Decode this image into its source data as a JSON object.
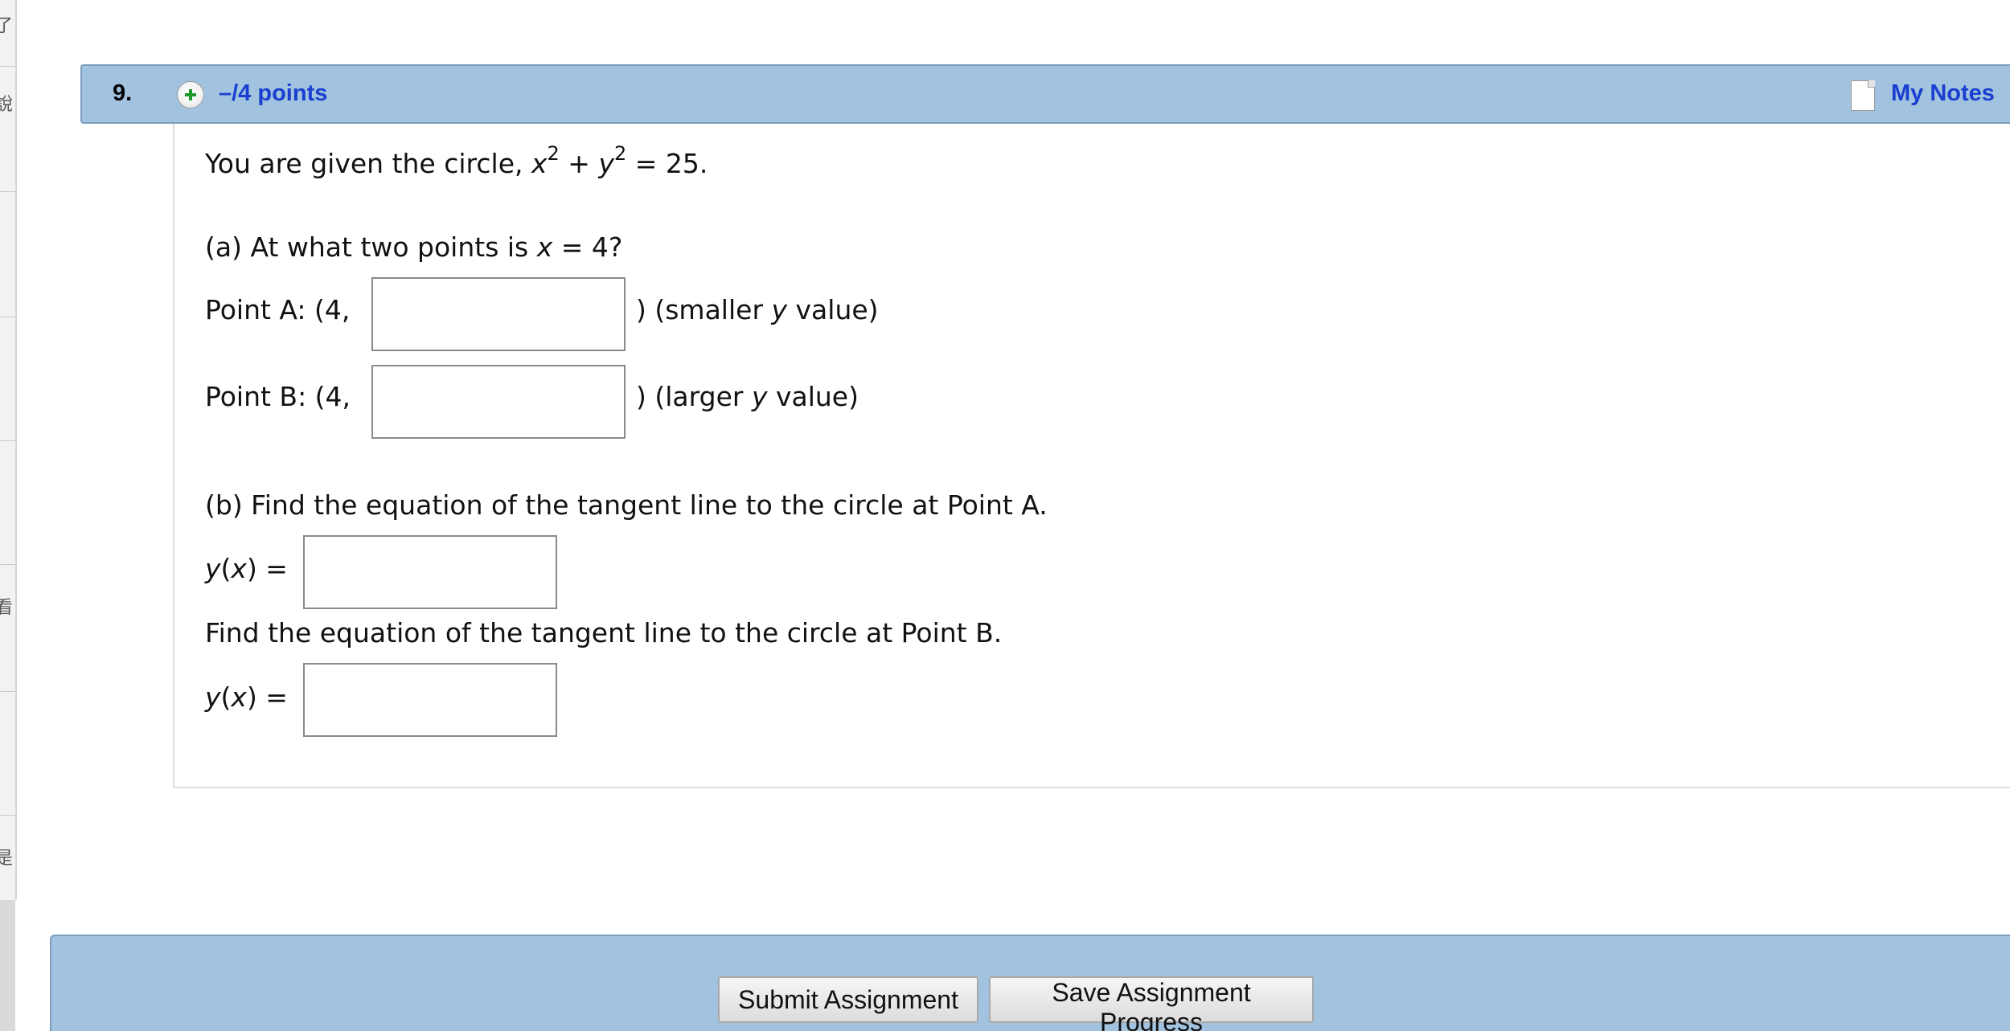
{
  "sidebar": {
    "glyphs": [
      "了",
      "說",
      "看",
      "是"
    ]
  },
  "question": {
    "number": "9.",
    "points": "–/4 points",
    "notes_label": "My Notes",
    "intro_prefix": "You are given the circle, ",
    "intro_equation": {
      "var_x": "x",
      "exp_x": "2",
      "plus": " + ",
      "var_y": "y",
      "exp_y": "2",
      "rhs": " = 25."
    },
    "part_a": {
      "prompt_prefix": "(a) At what two points is ",
      "prompt_var": "x",
      "prompt_suffix": " = 4?",
      "point_a": {
        "label": "Point A: (4,",
        "value": "",
        "suffix_prefix": ") (smaller ",
        "suffix_var": "y",
        "suffix_end": " value)"
      },
      "point_b": {
        "label": "Point B: (4,",
        "value": "",
        "suffix_prefix": ") (larger ",
        "suffix_var": "y",
        "suffix_end": " value)"
      }
    },
    "part_b": {
      "prompt_a": "(b) Find the equation of the tangent line to the circle at Point A.",
      "prompt_b": "Find the equation of the tangent line to the circle at Point B.",
      "func_y": "y",
      "func_open": "(",
      "func_x": "x",
      "func_close": ") =",
      "answer_a_value": "",
      "answer_b_value": ""
    }
  },
  "footer": {
    "submit_label": "Submit Assignment",
    "save_label": "Save Assignment Progress"
  }
}
